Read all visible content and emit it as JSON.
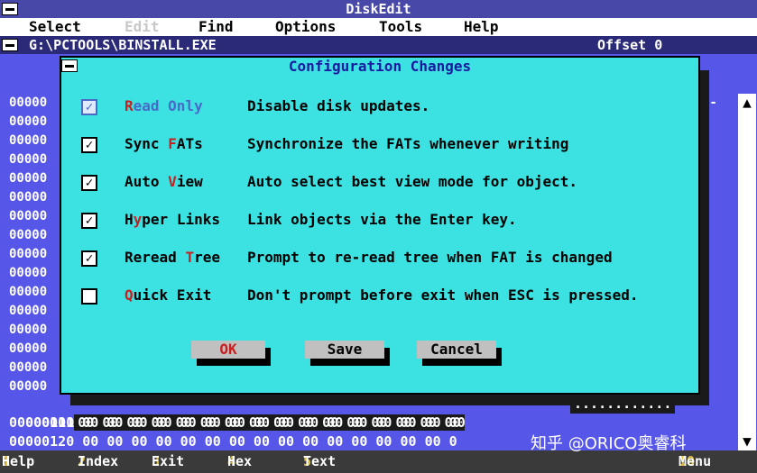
{
  "window": {
    "title": "DiskEdit"
  },
  "menu": {
    "items": [
      {
        "label": "Select",
        "disabled": false
      },
      {
        "label": "Edit",
        "disabled": true
      },
      {
        "label": "Find",
        "disabled": false
      },
      {
        "label": "Options",
        "disabled": false
      },
      {
        "label": "Tools",
        "disabled": false
      },
      {
        "label": "Help",
        "disabled": false
      }
    ]
  },
  "path": {
    "text": "G:\\PCTOOLS\\BINSTALL.EXE",
    "offset": "Offset 0"
  },
  "hex": {
    "addr_prefix": "00000",
    "row_100": "000001",
    "row_100_rest": "00 00 00 00 00 00 00 00 00 00 00 00 00 00 00 00",
    "row_110": "00000110 00 00 00 00 00 00 00 00 00 00 00 00 00 00 00 00",
    "row_120": "00000120 00 00 00 00 00 00 00 00 00 00 00 00 00 00 00 0",
    "dots": "............",
    "right_a": "à-"
  },
  "dialog": {
    "title": "Configuration Changes",
    "options": [
      {
        "pre": "",
        "hot": "",
        "post": "Read Only",
        "desc": "Disable disk updates.",
        "checked": true
      },
      {
        "pre": "Sync ",
        "hot": "F",
        "post": "ATs",
        "desc": "Synchronize the FATs whenever writing",
        "checked": true
      },
      {
        "pre": "Auto ",
        "hot": "V",
        "post": "iew",
        "desc": "Auto select best view mode for object.",
        "checked": true
      },
      {
        "pre": "H",
        "hot": "y",
        "post": "per Links",
        "desc": "Link objects via the Enter key.",
        "checked": true
      },
      {
        "pre": "Reread ",
        "hot": "T",
        "post": "ree",
        "desc": "Prompt to re-read tree when FAT is changed",
        "checked": true
      },
      {
        "pre": "",
        "hot": "Q",
        "post": "uick Exit",
        "desc": "Don't prompt before exit when ESC is pressed.",
        "checked": false
      }
    ],
    "buttons": {
      "ok": "OK",
      "save": "Save",
      "cancel": "Cancel"
    },
    "check_mark": "✓"
  },
  "status": [
    {
      "key": "1",
      "label": "Help"
    },
    {
      "key": "2",
      "label": "Index"
    },
    {
      "key": "3",
      "label": "Exit"
    },
    {
      "key": "4",
      "label": "Hex"
    },
    {
      "key": "5",
      "label": "Text"
    },
    {
      "key": "10",
      "label": "Menu"
    }
  ],
  "watermark": "知乎 @ORICO奥睿科",
  "colors": {
    "background": "#5656e8",
    "dialog": "#3ce2e2",
    "hotkey": "#c82020",
    "title": "#1a1aa0"
  }
}
